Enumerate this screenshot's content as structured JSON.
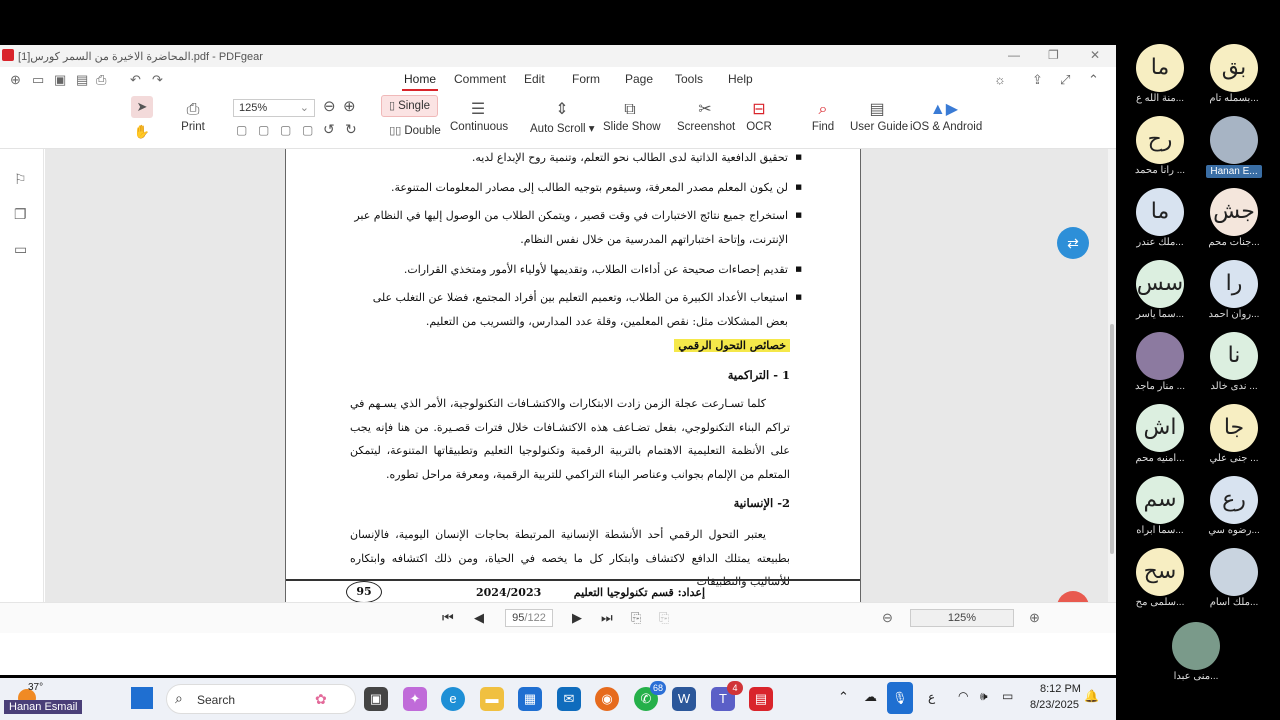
{
  "window": {
    "title": "المحاضرة الاخيرة من السمر كورس[1].pdf - PDFgear"
  },
  "menu": {
    "tabs": [
      "Home",
      "Comment",
      "Edit",
      "Form",
      "Page",
      "Tools",
      "Help"
    ],
    "active": "Home"
  },
  "toolbar": {
    "print": "Print",
    "zoom_value": "125%",
    "single": "Single",
    "double": "Double",
    "continuous": "Continuous",
    "auto_scroll": "Auto Scroll",
    "slide_show": "Slide Show",
    "screenshot": "Screenshot",
    "ocr": "OCR",
    "find": "Find",
    "user_guide": "User Guide",
    "ios_android": "iOS & Android"
  },
  "document": {
    "bullets": [
      "تحقيق الدافعية الذاتية لدى الطالب نحو التعلم، وتنمية روح الإبداع لديه.",
      "لن يكون المعلم مصدر المعرفة، وسيقوم بتوجيه الطالب إلى مصادر المعلومات المتنوعة.",
      "استخراج جميع نتائج الاختبارات في وقت قصير ، ويتمكن الطلاب من الوصول إليها في النظام عبر الإنترنت، وإتاحة اختباراتهم المدرسية من خلال نفس النظام.",
      "تقديم إحصاءات صحيحة عن أداءات الطلاب، وتقديمها لأولياء الأمور ومتخذي القرارات.",
      "استيعاب الأعداد الكبيرة من الطلاب، وتعميم التعليم بين أفراد المجتمع، فضلا عن التغلب على بعض المشكلات مثل: نقص المعلمين، وقلة عدد المدارس، والتسريب من التعليم."
    ],
    "section_heading": "خصائص التحول الرقمي",
    "sub1": "1 - التراكمية",
    "para1": "كلما تسـارعت عجلة الزمن زادت الابتكارات والاكتشـافات التكنولوجية، الأمر الذي يسـهم في تراكم البناء التكنولوجي، بفعل تضـاعف هذه الاكتشـافات خلال فترات قصـيرة. من هنا فإنه يجب على الأنظمة التعليمية الاهتمام بالتربية الرقمية وتكنولوجيا التعليم وتطبيقاتها المتنوعة، ليتمكن المتعلم من الإلمام بجوانب وعناصر البناء التراكمي للتربية الرقمية، ومعرفة مراحل تطوره.",
    "sub2": "2- الإنسانية",
    "para2": "يعتبر التحول الرقمي أحد الأنشطة الإنسانية المرتبطة بحاجات الإنسان اليومية، فالإنسان بطبيعته يمتلك الدافع لاكتشاف وابتكار كل ما يخصه في الحياة، ومن ذلك اكتشافه وابتكاره للأساليب والتطبيقات",
    "footer_dept": "إعداد: قسم تكنولوجيا التعليم",
    "footer_year": "2024/2023",
    "page_number": "95"
  },
  "status": {
    "page": "95",
    "total": "/122",
    "zoom": "125%"
  },
  "taskbar": {
    "weather": "37°",
    "search": "Search",
    "time": "8:12 PM",
    "date": "8/23/2025",
    "lang": "ع",
    "badge_whatsapp": "68",
    "badge_teams": "4"
  },
  "participants": [
    {
      "initials": "ما",
      "name": "منة الله ع...",
      "color": "#f7eec2"
    },
    {
      "initials": "بق",
      "name": "بسمله تام...",
      "color": "#f7eec2"
    },
    {
      "initials": "رح",
      "name": "رانا محمد ...",
      "color": "#f7eec2"
    },
    {
      "initials": "",
      "name": "Hanan E...",
      "color": "#a7b4c4",
      "highlight": true
    },
    {
      "initials": "ما",
      "name": "ملك عندر...",
      "color": "#d8e3f0"
    },
    {
      "initials": "جش",
      "name": "جنات محم...",
      "color": "#f4e6dc"
    },
    {
      "initials": "سس",
      "name": "سما ياسر...",
      "color": "#dcefe0"
    },
    {
      "initials": "را",
      "name": "روان احمد...",
      "color": "#d8e3f0"
    },
    {
      "initials": "",
      "name": "منار ماجد ...",
      "color": "#8c7aa0"
    },
    {
      "initials": "نا",
      "name": "ندى خالد ...",
      "color": "#dcefe0"
    },
    {
      "initials": "اش",
      "name": "امنيه محم...",
      "color": "#dcefe0"
    },
    {
      "initials": "جا",
      "name": "جنى علي ...",
      "color": "#f7eec2"
    },
    {
      "initials": "سم",
      "name": "سما ابراه...",
      "color": "#dcefe0"
    },
    {
      "initials": "رع",
      "name": "رضوه سي...",
      "color": "#d8e3f0"
    },
    {
      "initials": "سح",
      "name": "سلمى مح...",
      "color": "#f7eec2"
    },
    {
      "initials": "",
      "name": "ملك اسام...",
      "color": "#c9d4e0"
    },
    {
      "initials": "",
      "name": "منى عبدا...",
      "color": "#7a9a8a"
    }
  ],
  "speaker": "Hanan Esmail"
}
